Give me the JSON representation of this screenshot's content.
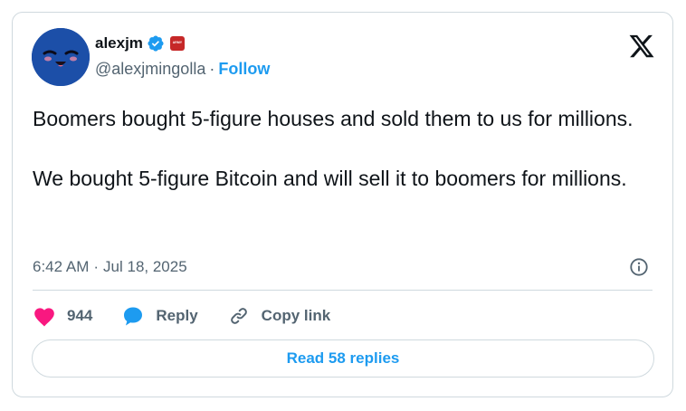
{
  "author": {
    "display_name": "alexjm",
    "handle": "@alexjmingolla",
    "follow_label": "Follow",
    "separator": "·",
    "verified_icon": "verified-badge-icon",
    "affiliation_badge_text": "ARMY"
  },
  "tweet": {
    "text": "Boomers bought 5-figure houses and sold them to us for millions.\n\nWe bought 5-figure Bitcoin and will sell it to boomers for millions.",
    "time": "6:42 AM",
    "date": "Jul 18, 2025",
    "separator": "·"
  },
  "actions": {
    "like_count": "944",
    "reply_label": "Reply",
    "copy_link_label": "Copy link"
  },
  "read_replies_label": "Read 58 replies",
  "colors": {
    "accent": "#1d9bf0",
    "like": "#f91880",
    "text": "#0f1419",
    "secondary": "#536471",
    "border": "#cfd9de",
    "avatar_bg": "#1c4fa8"
  },
  "icons": [
    "x-logo-icon",
    "info-icon",
    "heart-icon",
    "reply-bubble-icon",
    "link-icon"
  ]
}
